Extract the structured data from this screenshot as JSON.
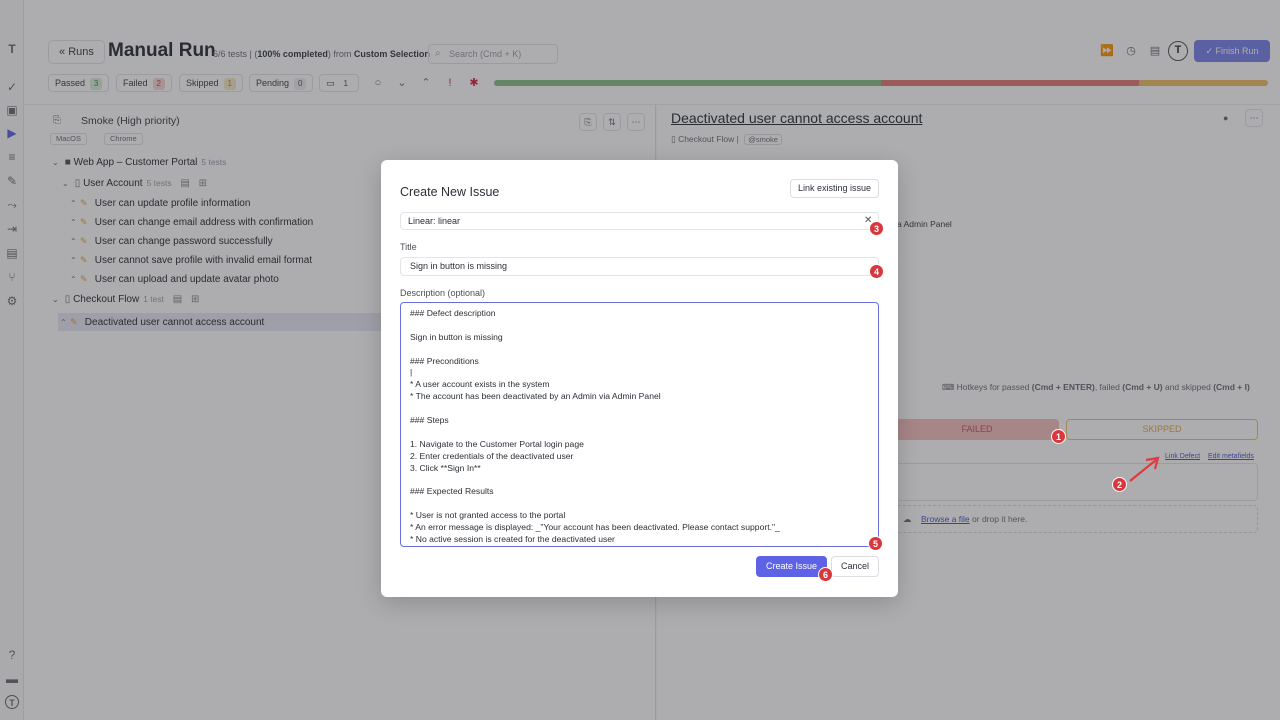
{
  "header": {
    "runs_label": "Runs",
    "title": "Manual Run",
    "stats_prefix": "6/6 tests | ",
    "stats_pct": "100% completed",
    "stats_from": ") from ",
    "stats_source": "Custom Selection",
    "search_placeholder": "Search (Cmd + K)",
    "finish_label": "Finish Run",
    "avatar_letter": "T"
  },
  "status": {
    "passed_label": "Passed",
    "passed_count": "3",
    "failed_label": "Failed",
    "failed_count": "2",
    "skipped_label": "Skipped",
    "skipped_count": "1",
    "pending_label": "Pending",
    "pending_count": "0",
    "notes_count": "1"
  },
  "progress": {
    "passed": 0.5,
    "failed": 0.333,
    "skipped": 0.167,
    "colors": {
      "passed": "#86c08a",
      "failed": "#e27a7a",
      "skipped": "#ecc06a"
    }
  },
  "plan": {
    "name": "Smoke (High priority)",
    "tags": [
      "MacOS",
      "Chrome"
    ]
  },
  "tree": {
    "suite": {
      "name": "Web App – Customer Portal",
      "count": "5 tests"
    },
    "group1": {
      "name": "User Account",
      "count": "5 tests"
    },
    "items": [
      "User can update profile information",
      "User can change email address with confirmation",
      "User can change password successfully",
      "User cannot save profile with invalid email format",
      "User can upload and update avatar photo"
    ],
    "group2": {
      "name": "Checkout Flow",
      "count": "1 test"
    },
    "selected": "Deactivated user cannot access account"
  },
  "detail": {
    "title": "Deactivated user cannot access account",
    "suite": "Checkout Flow",
    "tag": "@smoke",
    "admin_text": "a Admin Panel",
    "hotkeys_prefix": "Hotkeys for passed ",
    "hotkey_pass": "(Cmd + ENTER)",
    "hotkeys_mid1": ", failed ",
    "hotkey_fail": "(Cmd + U)",
    "hotkeys_mid2": " and skipped ",
    "hotkey_skip": "(Cmd + I)",
    "failed_label": "FAILED",
    "skipped_label": "SKIPPED",
    "link_defect": "Link Defect",
    "edit_metafields": "Edit metafields",
    "browse_link": "Browse a file",
    "drop_text": " or drop it here."
  },
  "modal": {
    "title": "Create New Issue",
    "link_existing": "Link existing issue",
    "tracker_value": "Linear: linear",
    "title_label": "Title",
    "title_value": "Sign in button is missing",
    "description_label": "Description (optional)",
    "description_lines": [
      "### Defect description",
      "",
      "Sign in button is missing",
      "",
      "### Preconditions",
      "|",
      "* A user account exists in the system",
      "* The account has been deactivated by an Admin via Admin Panel",
      "",
      "### Steps",
      "",
      "1. Navigate to the Customer Portal login page",
      "2. Enter credentials of the deactivated user",
      "3. Click **Sign In**",
      "",
      "### Expected Results",
      "",
      "* User is not granted access to the portal",
      "* An error message is displayed: _\"Your account has been deactivated. Please contact support.\"_",
      "* No active session is created for the deactivated user"
    ],
    "create_label": "Create Issue",
    "cancel_label": "Cancel"
  },
  "markers": [
    "1",
    "2",
    "3",
    "4",
    "5",
    "6"
  ]
}
